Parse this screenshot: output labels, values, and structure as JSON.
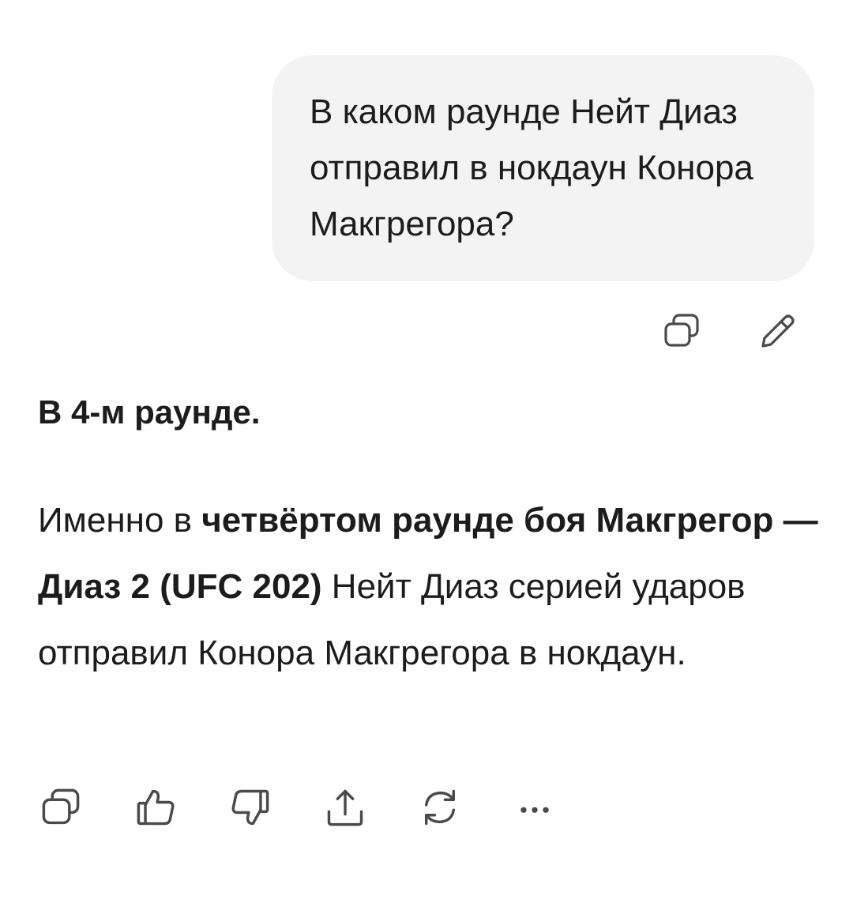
{
  "user_message": {
    "text": "В каком раунде Нейт Диаз отправил в нокдаун Конора Макгрегора?"
  },
  "user_actions": [
    {
      "icon": "copy-icon"
    },
    {
      "icon": "edit-pencil-icon"
    }
  ],
  "assistant_message": {
    "title": "В 4-м раунде.",
    "body_parts": {
      "p1": "Именно в ",
      "b1": "четвёртом раунде боя Макгрегор — Диаз 2 (UFC 202)",
      "p2": " Нейт Диаз серией ударов отправил Конора Макгрегора в нокдаун."
    }
  },
  "assistant_actions": [
    {
      "icon": "copy-icon"
    },
    {
      "icon": "thumbs-up-icon"
    },
    {
      "icon": "thumbs-down-icon"
    },
    {
      "icon": "share-icon"
    },
    {
      "icon": "regenerate-icon"
    },
    {
      "icon": "more-icon"
    }
  ],
  "colors": {
    "bubble_bg": "#f3f3f3",
    "text": "#1c1c1c",
    "icon": "#4a4a4a"
  }
}
